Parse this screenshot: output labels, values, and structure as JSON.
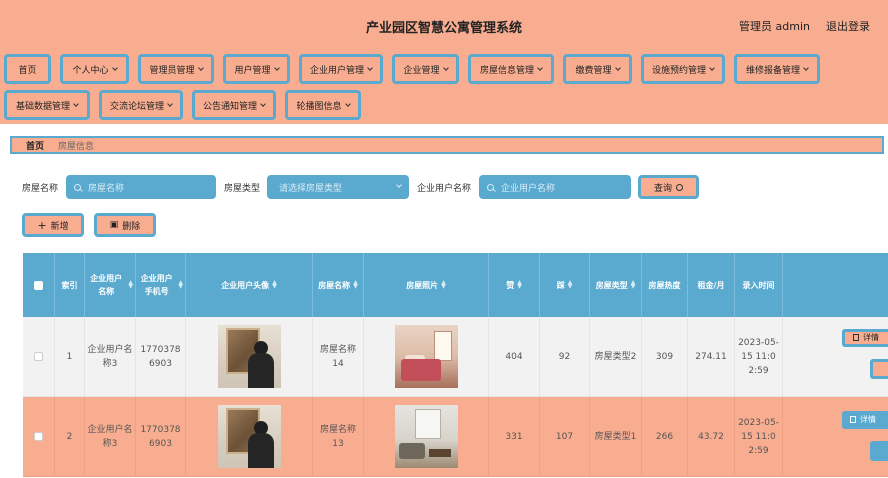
{
  "header": {
    "title": "产业园区智慧公寓管理系统",
    "user": "管理员 admin",
    "logout": "退出登录"
  },
  "nav": {
    "row1": [
      {
        "label": "首页",
        "dropdown": false
      },
      {
        "label": "个人中心",
        "dropdown": true
      },
      {
        "label": "管理员管理",
        "dropdown": true
      },
      {
        "label": "用户管理",
        "dropdown": true
      },
      {
        "label": "企业用户管理",
        "dropdown": true
      },
      {
        "label": "企业管理",
        "dropdown": true
      },
      {
        "label": "房屋信息管理",
        "dropdown": true
      },
      {
        "label": "缴费管理",
        "dropdown": true
      },
      {
        "label": "设施预约管理",
        "dropdown": true
      },
      {
        "label": "维修报备管理",
        "dropdown": true
      }
    ],
    "row2": [
      {
        "label": "基础数据管理",
        "dropdown": true
      },
      {
        "label": "交流论坛管理",
        "dropdown": true
      },
      {
        "label": "公告通知管理",
        "dropdown": true
      },
      {
        "label": "轮播图信息",
        "dropdown": true
      }
    ]
  },
  "breadcrumb": {
    "home": "首页",
    "current": "房屋信息"
  },
  "search": {
    "name_label": "房屋名称",
    "name_placeholder": "房屋名称",
    "type_label": "房屋类型",
    "type_placeholder": "请选择房屋类型",
    "company_label": "企业用户名称",
    "company_placeholder": "企业用户名称",
    "query_button": "查询"
  },
  "actions": {
    "add": "新增",
    "delete": "删除"
  },
  "table": {
    "headers": {
      "index": "索引",
      "company_user": "企业用户名称",
      "phone": "企业用户手机号",
      "avatar": "企业用户头像",
      "house_name": "房屋名称",
      "house_photo": "房屋照片",
      "likes": "赞",
      "dislikes": "踩",
      "house_type": "房屋类型",
      "heat": "房屋热度",
      "rent": "租金/月",
      "created": "录入时间"
    },
    "rows": [
      {
        "index": "1",
        "company_user": "企业用户名称3",
        "phone": "17703786903",
        "house_name": "房屋名称14",
        "likes": "404",
        "dislikes": "92",
        "house_type": "房屋类型2",
        "heat": "309",
        "rent": "274.11",
        "created": "2023-05-15 11:02:59",
        "detail": "详情"
      },
      {
        "index": "2",
        "company_user": "企业用户名称3",
        "phone": "17703786903",
        "house_name": "房屋名称13",
        "likes": "331",
        "dislikes": "107",
        "house_type": "房屋类型1",
        "heat": "266",
        "rent": "43.72",
        "created": "2023-05-15 11:02:59",
        "detail": "详情"
      }
    ]
  },
  "colors": {
    "accent_blue": "#5aa9cf",
    "salmon": "#f9ad90"
  }
}
